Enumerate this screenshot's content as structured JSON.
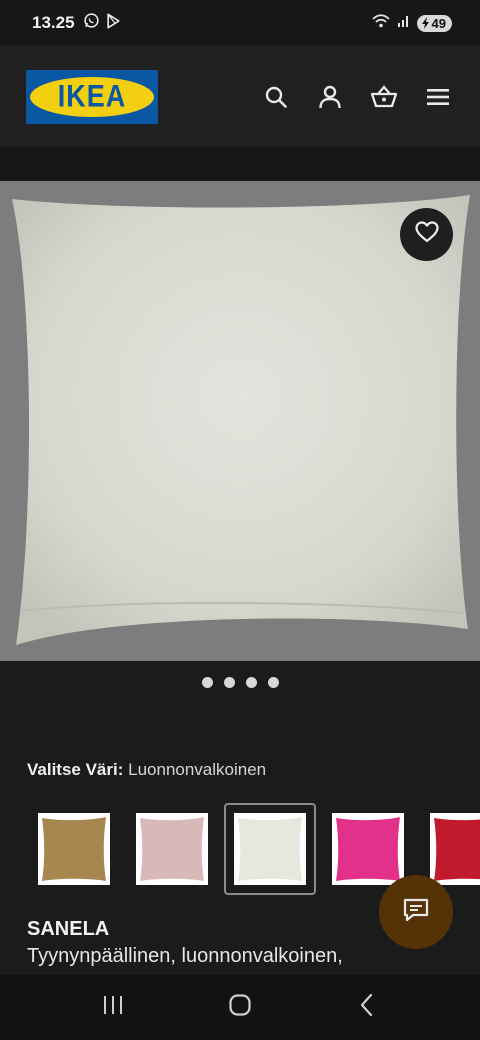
{
  "status_bar": {
    "time": "13.25",
    "battery": "49",
    "icons": [
      "whatsapp-icon",
      "play-store-icon",
      "wifi-icon",
      "signal-icon",
      "battery-icon"
    ]
  },
  "header": {
    "logo_text": "IKEA",
    "icons": [
      "search-icon",
      "account-icon",
      "basket-icon",
      "menu-icon"
    ]
  },
  "product": {
    "image_alt": "Cushion cover, natural white",
    "carousel_count": 4,
    "color_label": "Valitse Väri:",
    "color_value": "Luonnonvalkoinen",
    "swatches": [
      {
        "name": "swatch-golden-brown",
        "color": "#a8864f"
      },
      {
        "name": "swatch-light-pink",
        "color": "#d8b9b7"
      },
      {
        "name": "swatch-natural-white",
        "color": "#e8e8dc",
        "selected": true
      },
      {
        "name": "swatch-pink",
        "color": "#e2318a"
      },
      {
        "name": "swatch-red",
        "color": "#c01a2c"
      }
    ],
    "name": "SANELA",
    "description": "Tyynynpäällinen, luonnonvalkoinen,"
  },
  "colors": {
    "background": "#1b1b1c",
    "ikea_blue": "#0a58a3",
    "ikea_yellow": "#f2cf10",
    "chat_button": "#553306"
  }
}
